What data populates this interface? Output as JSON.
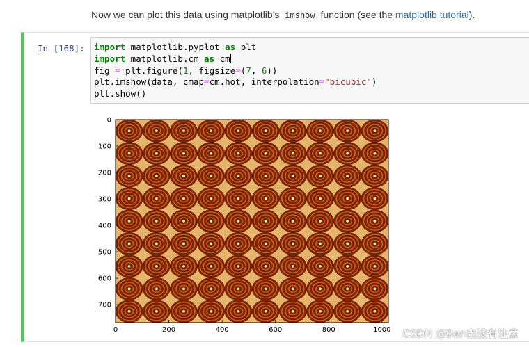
{
  "markdown": {
    "text_before": "Now we can plot this data using matplotlib's ",
    "code_word": "imshow",
    "text_middle": " function (see the ",
    "link_text": "matplotlib tutorial",
    "text_after": ")."
  },
  "cell": {
    "prompt": "In  [168]:",
    "code": {
      "l1_kw": "import",
      "l1_rest": " matplotlib.pyplot ",
      "l1_as": "as",
      "l1_alias": " plt",
      "l2_kw": "import",
      "l2_rest": " matplotlib.cm ",
      "l2_as": "as",
      "l2_alias": " cm",
      "l3_a": "fig ",
      "l3_eq": "=",
      "l3_b": " plt.figure(",
      "l3_n1": "1",
      "l3_c": ", figsize",
      "l3_eq2": "=",
      "l3_d": "(",
      "l3_n2": "7",
      "l3_e": ", ",
      "l3_n3": "6",
      "l3_f": "))",
      "l4_a": "plt.imshow(data, cmap",
      "l4_eq": "=",
      "l4_b": "cm.hot, interpolation",
      "l4_eq2": "=",
      "l4_str": "\"bicubic\"",
      "l4_c": ")",
      "l5": "plt.show()"
    }
  },
  "chart_data": {
    "type": "heatmap",
    "title": "",
    "xlabel": "",
    "ylabel": "",
    "xlim": [
      0,
      1024
    ],
    "ylim": [
      768,
      0
    ],
    "x_ticks": [
      "0",
      "200",
      "400",
      "600",
      "800",
      "1000"
    ],
    "y_ticks": [
      "0",
      "100",
      "200",
      "300",
      "400",
      "500",
      "600",
      "700"
    ],
    "x_tick_values": [
      0,
      200,
      400,
      600,
      800,
      1000
    ],
    "y_tick_values": [
      0,
      100,
      200,
      300,
      400,
      500,
      600,
      700
    ],
    "colormap": "hot",
    "pattern": "periodic concentric-ring interference tiles",
    "colors": {
      "background": "#c8641a",
      "ring": "#8b2200",
      "highlight": "#fff8b0",
      "dark": "#2a0000"
    }
  },
  "watermark": "CSDN @Ben出没有注意"
}
